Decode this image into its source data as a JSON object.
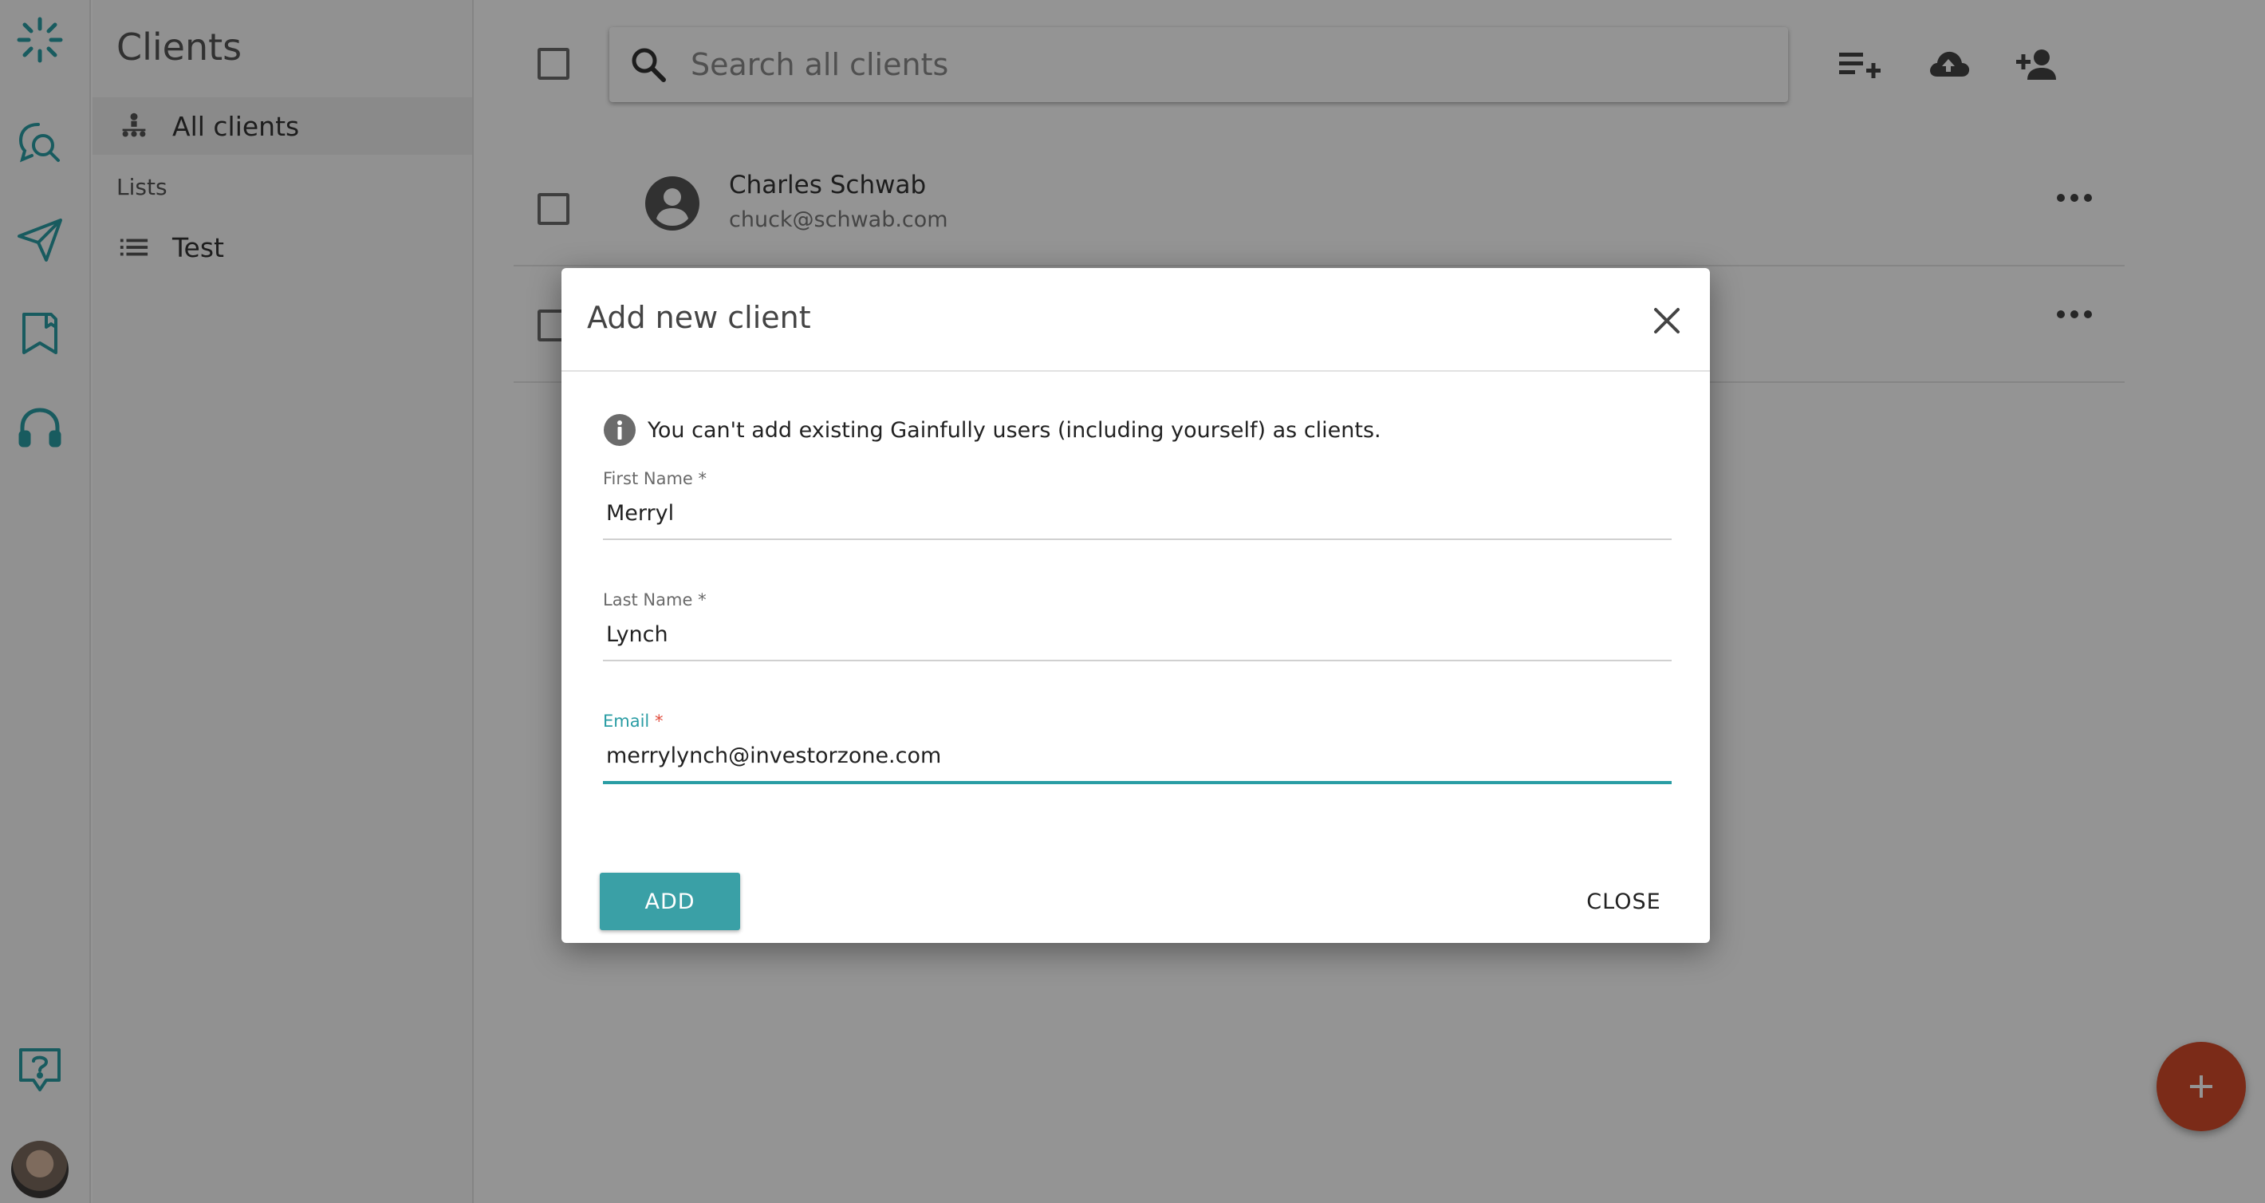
{
  "colors": {
    "accent": "#2a9da4",
    "fab": "#d44b2a",
    "required": "#e14b3b"
  },
  "rail": {
    "icons": [
      "logo-icon",
      "search-chat-icon",
      "send-icon",
      "bookmark-icon",
      "headphones-icon",
      "help-icon"
    ]
  },
  "sidebar": {
    "title": "Clients",
    "all_clients": "All clients",
    "lists_header": "Lists",
    "lists": [
      {
        "label": "Test"
      }
    ]
  },
  "main": {
    "search_placeholder": "Search all clients",
    "clients": [
      {
        "name": "Charles Schwab",
        "email": "chuck@schwab.com"
      },
      {
        "name": "",
        "email": ""
      }
    ]
  },
  "dialog": {
    "title": "Add new client",
    "info": "You can't add existing Gainfully users (including yourself) as clients.",
    "first_name": {
      "label": "First Name",
      "required": "*",
      "value": "Merryl"
    },
    "last_name": {
      "label": "Last Name",
      "required": "*",
      "value": "Lynch"
    },
    "email": {
      "label": "Email",
      "required": "*",
      "value": "merrylynch@investorzone.com"
    },
    "add_label": "ADD",
    "close_label": "CLOSE"
  }
}
